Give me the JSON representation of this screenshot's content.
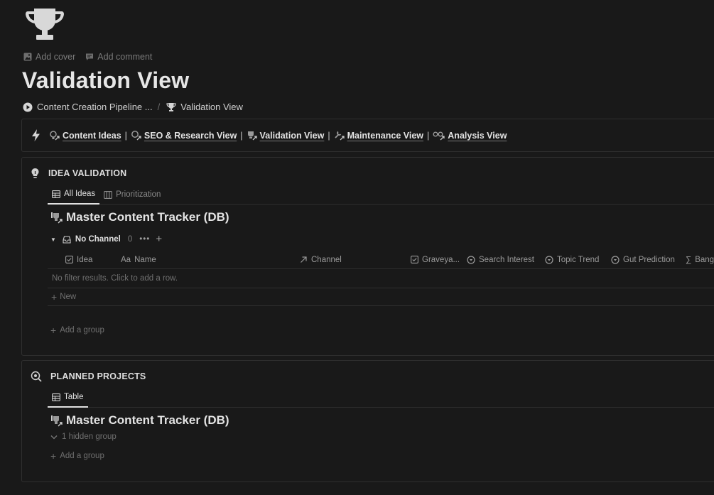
{
  "page": {
    "icon": "trophy-icon",
    "title": "Validation View",
    "controls": {
      "add_cover": "Add cover",
      "add_comment": "Add comment"
    }
  },
  "breadcrumb": {
    "parent": "Content Creation Pipeline ...",
    "separator": "/",
    "current": "Validation View"
  },
  "nav_links": [
    {
      "label": "Content Ideas",
      "icon": "idea-link-icon"
    },
    {
      "label": "SEO & Research View",
      "icon": "search-link-icon"
    },
    {
      "label": "Validation View",
      "icon": "trophy-link-icon"
    },
    {
      "label": "Maintenance View",
      "icon": "wrench-link-icon"
    },
    {
      "label": "Analysis View",
      "icon": "glasses-link-icon"
    }
  ],
  "nav_separator": "|",
  "idea_validation": {
    "heading": "IDEA VALIDATION",
    "tabs": [
      {
        "label": "All Ideas",
        "active": true
      },
      {
        "label": "Prioritization",
        "active": false
      }
    ],
    "db_title": "Master Content Tracker (DB)",
    "group": {
      "name": "No Channel",
      "count": "0",
      "more": "•••",
      "add": "+"
    },
    "columns": [
      "Idea",
      "Name",
      "Channel",
      "Graveya...",
      "Search Interest",
      "Topic Trend",
      "Gut Prediction",
      "Banger?"
    ],
    "column_prefix_name": "Aa",
    "column_prefix_banger": "∑",
    "empty_text": "No filter results. Click to add a row.",
    "new_label": "New",
    "add_group": "Add a group"
  },
  "planned_projects": {
    "heading": "PLANNED PROJECTS",
    "tabs": [
      {
        "label": "Table",
        "active": true
      }
    ],
    "db_title": "Master Content Tracker (DB)",
    "hidden_group": "1 hidden group",
    "add_group": "Add a group"
  }
}
